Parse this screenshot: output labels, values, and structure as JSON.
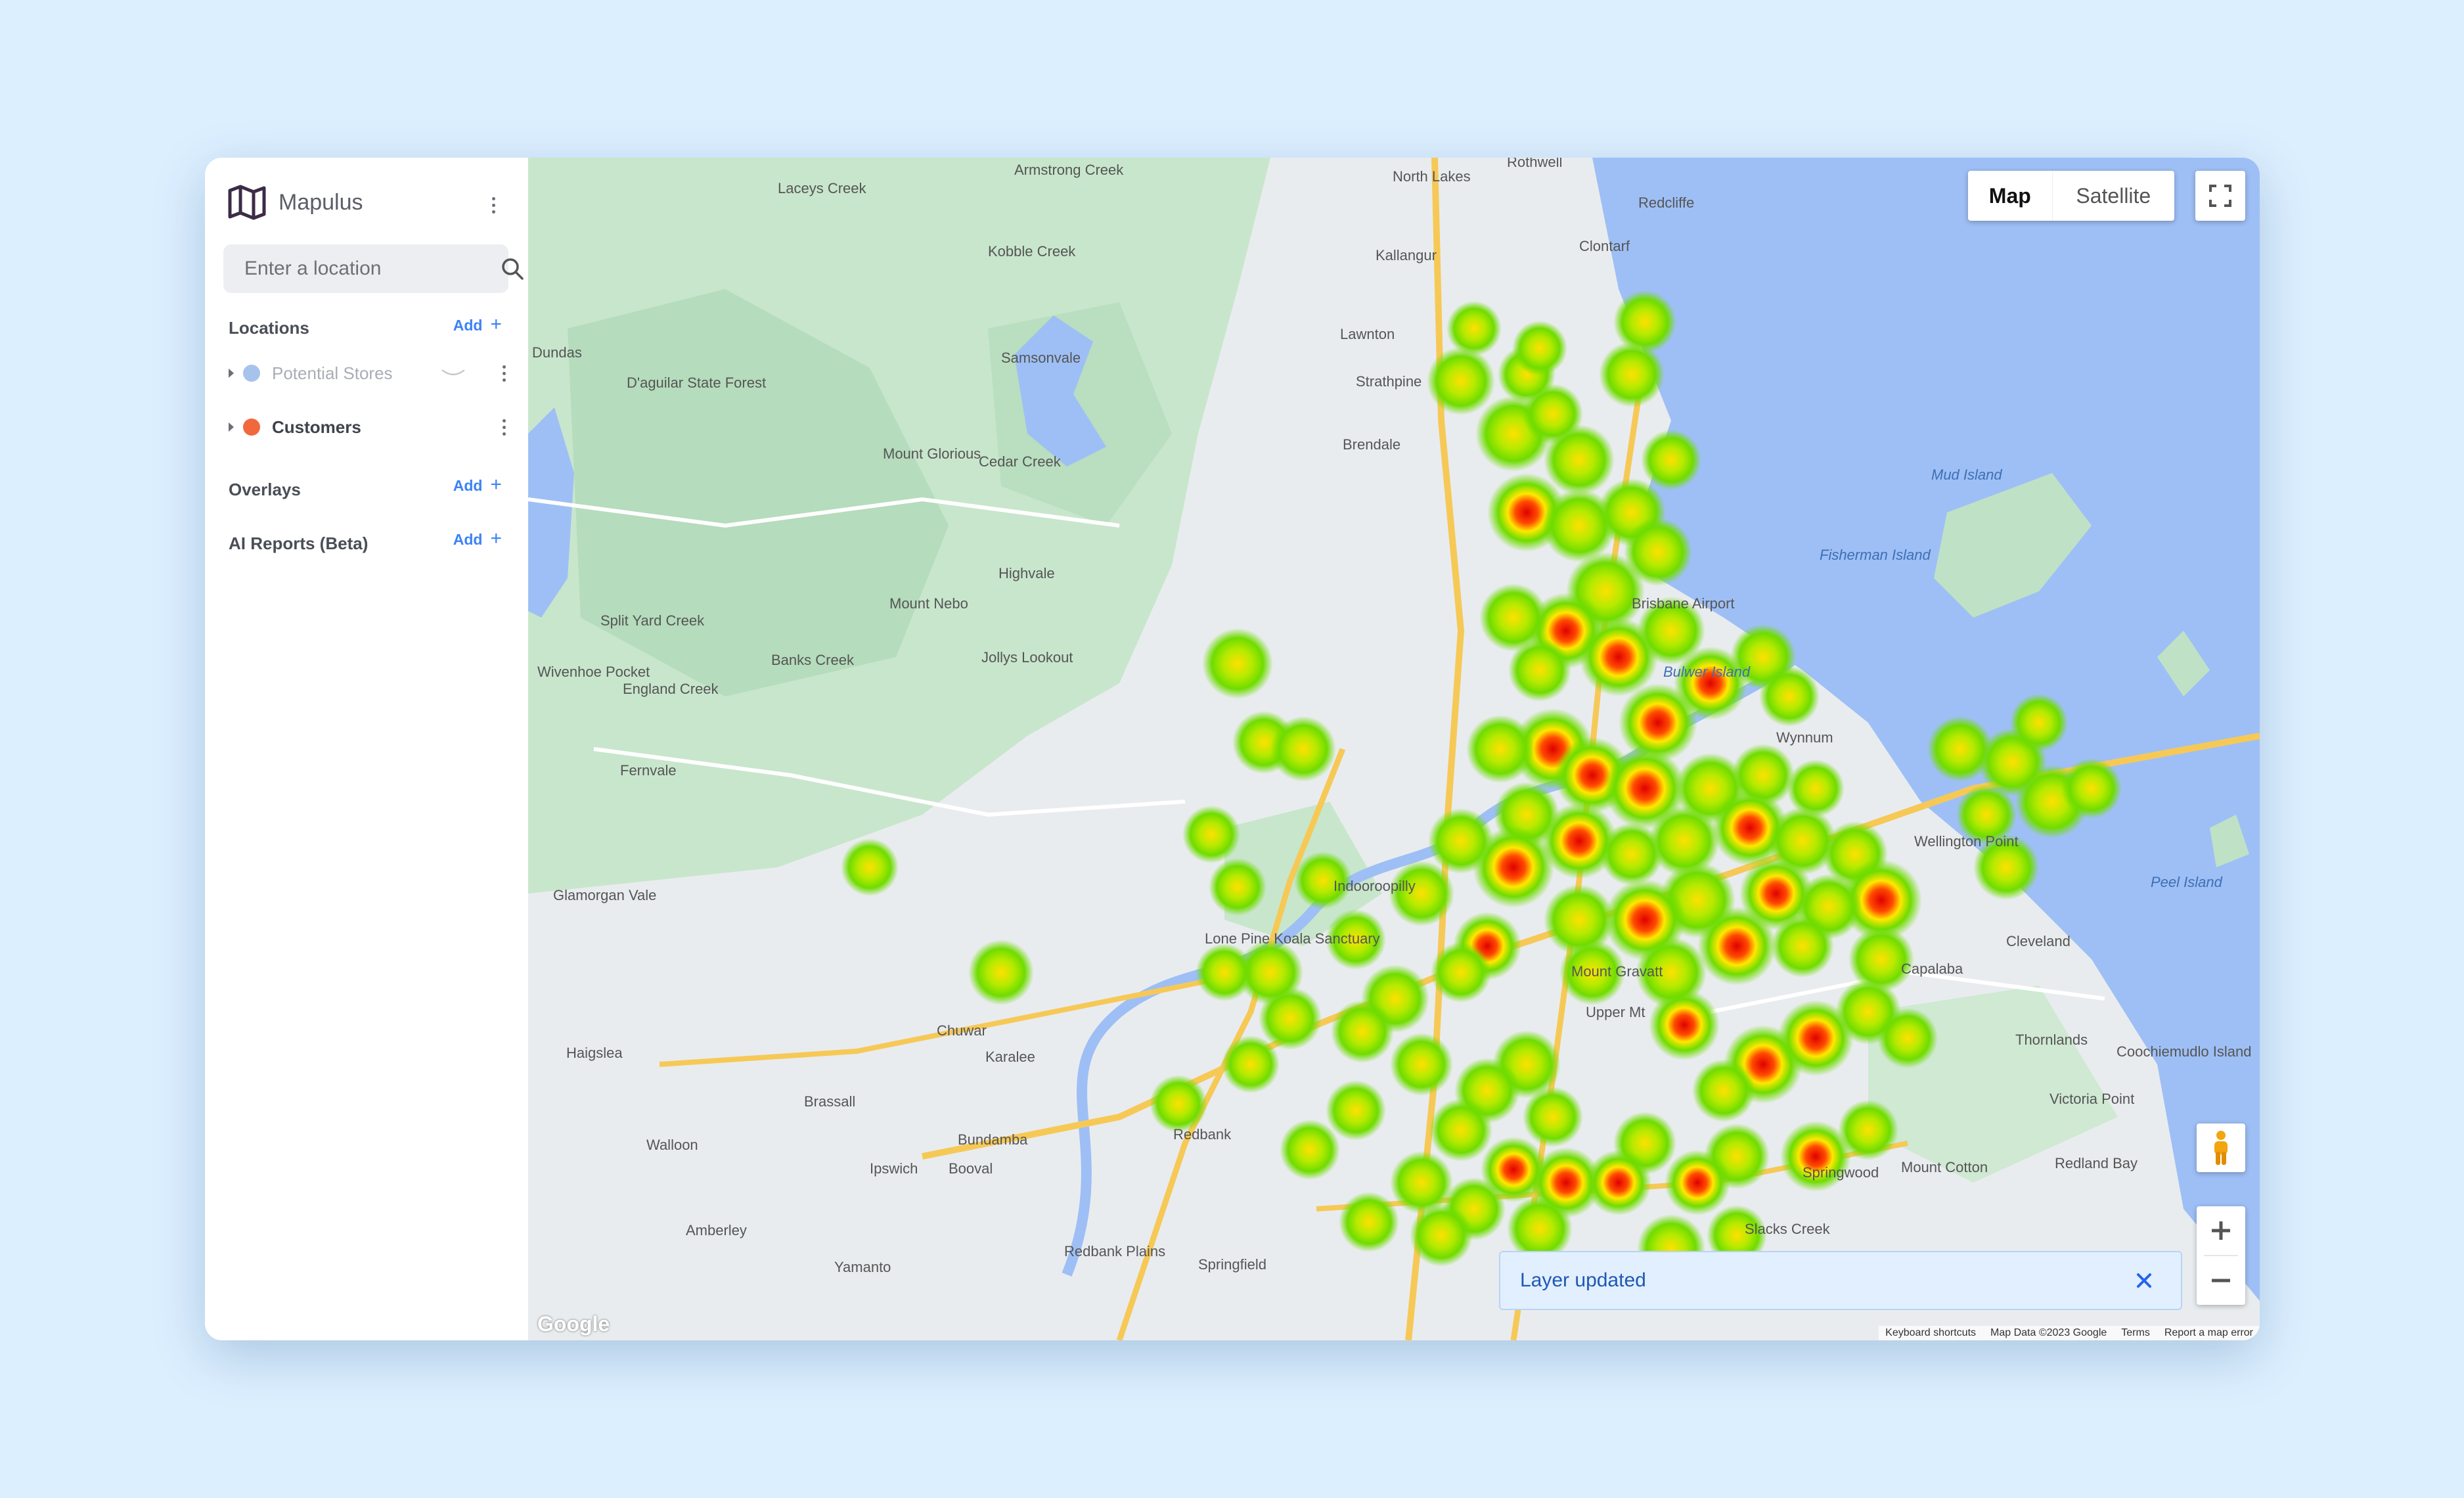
{
  "app": {
    "name": "Mapulus"
  },
  "search": {
    "placeholder": "Enter a location"
  },
  "sections": {
    "locations": {
      "title": "Locations",
      "add_label": "Add"
    },
    "overlays": {
      "title": "Overlays",
      "add_label": "Add"
    },
    "ai_reports": {
      "title": "AI Reports (Beta)",
      "add_label": "Add"
    }
  },
  "layers": [
    {
      "label": "Potential Stores",
      "color": "#a7c3ec",
      "state": "loading"
    },
    {
      "label": "Customers",
      "color": "#f0683c",
      "state": "ready"
    }
  ],
  "map_type": {
    "options": [
      "Map",
      "Satellite"
    ],
    "selected": "Map"
  },
  "toast": {
    "text": "Layer updated"
  },
  "attribution": {
    "logo": "Google",
    "links": [
      "Keyboard shortcuts",
      "Map Data ©2023 Google",
      "Terms",
      "Report a map error"
    ]
  },
  "map_labels": [
    "Laceys Creek",
    "Armstrong Creek",
    "Kobble Creek",
    "Rothwell",
    "North Lakes",
    "Redcliffe",
    "Kallangur",
    "Clontarf",
    "Samsonvale",
    "Lawnton",
    "Dundas",
    "D'aguilar State Forest",
    "Strathpine",
    "Brendale",
    "Mount Glorious",
    "Cedar Creek",
    "Mud Island",
    "Fisherman Island",
    "Highvale",
    "Mount Nebo",
    "Brisbane Airport",
    "Split Yard Creek",
    "Jollys Lookout",
    "Banks Creek",
    "Wivenhoe Pocket",
    "England Creek",
    "Bulwer Island",
    "Wynnum",
    "Fernvale",
    "Wellington Point",
    "Glamorgan Vale",
    "Indooroopilly",
    "Lone Pine Koala Sanctuary",
    "Peel Island",
    "Mount Gravatt",
    "Cleveland",
    "Capalaba",
    "Chuwar",
    "Upper Mt",
    "Haigslea",
    "Karalee",
    "Thornlands",
    "Coochiemudlo Island",
    "Brassall",
    "Victoria Point",
    "Walloon",
    "Bundamba",
    "Redbank",
    "Ipswich",
    "Booval",
    "Springwood",
    "Mount Cotton",
    "Redland Bay",
    "Amberley",
    "Slacks Creek",
    "Yamanto",
    "Redbank Plains",
    "Springfield"
  ],
  "colors": {
    "accent": "#3b82f6",
    "water": "#9ebff5",
    "land": "#e8ebef",
    "park": "#bfe2c6"
  }
}
